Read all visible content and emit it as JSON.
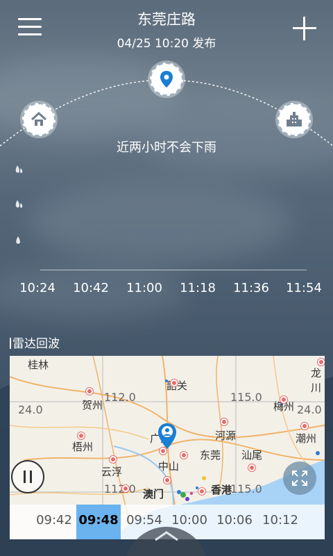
{
  "header": {
    "location": "东莞庄路",
    "published": "04/25  10:20 发布",
    "menu_icon": "menu-icon",
    "add_icon": "plus-icon"
  },
  "forecast": {
    "message": "近两小时不会下雨",
    "home_icon": "home-icon",
    "location_icon": "location-pin-icon",
    "work_icon": "office-building-icon",
    "times": [
      "10:24",
      "10:42",
      "11:00",
      "11:18",
      "11:36",
      "11:54"
    ]
  },
  "radar": {
    "title": "雷达回波",
    "map_labels": {
      "guilin": "桂林",
      "shaoguan": "韶关",
      "longchuan": "龙川",
      "hezhou": "贺州",
      "wuzhou": "梧州",
      "guangzhou": "广州",
      "heyuan": "河源",
      "meizhou": "梅州",
      "chaozhou": "潮州",
      "zhaoqing": "中山",
      "dongguan": "东莞",
      "shanwei": "汕尾",
      "yunfu": "云浮",
      "macau": "澳门",
      "hongkong": "香港",
      "lat24": "24.0",
      "lat24r": "24.0",
      "lon112": "112.0",
      "lon115": "115.0",
      "lon112b": "112.0",
      "lon115b": "115.0"
    },
    "times": [
      "09:42",
      "09:48",
      "09:54",
      "10:00",
      "10:06",
      "10:12"
    ],
    "selected_time": "09:48",
    "pause_icon": "pause-icon",
    "expand_icon": "expand-icon",
    "pull_icon": "chevron-up-icon"
  }
}
